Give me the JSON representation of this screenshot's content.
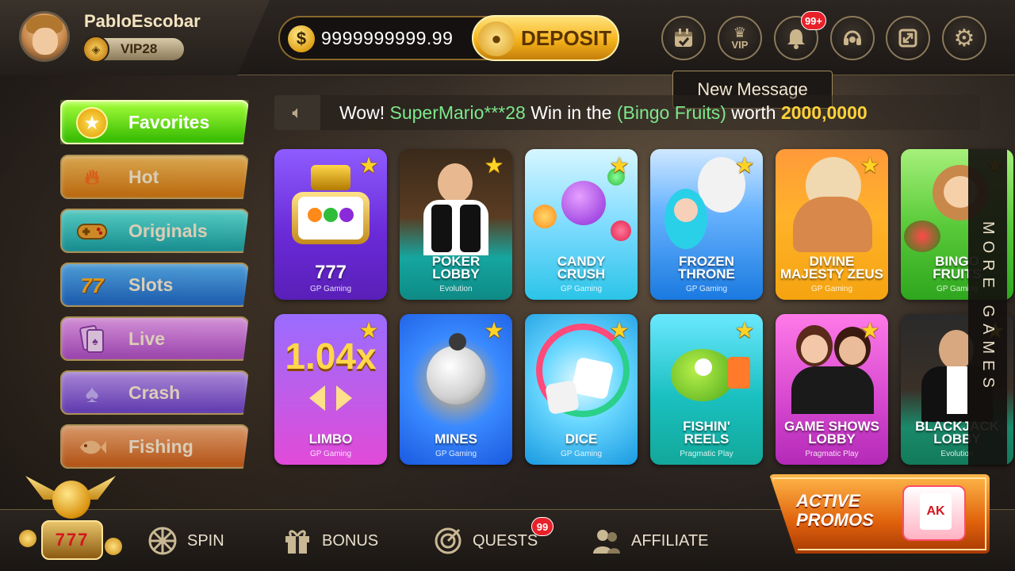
{
  "header": {
    "username": "PabloEscobar",
    "vip_label": "VIP28",
    "balance": "9999999999.99",
    "deposit_label": "DEPOSIT",
    "icons": [
      {
        "name": "calendar-icon"
      },
      {
        "name": "vip-crown-icon",
        "label": "VIP"
      },
      {
        "name": "bell-icon",
        "badge": "99+"
      },
      {
        "name": "support-headset-icon"
      },
      {
        "name": "fullscreen-icon"
      },
      {
        "name": "settings-gear-icon"
      }
    ],
    "tooltip": "New Message"
  },
  "sidebar": {
    "categories": [
      {
        "label": "Favorites",
        "icon": "star-icon",
        "active": true
      },
      {
        "label": "Hot",
        "icon": "flame-icon"
      },
      {
        "label": "Originals",
        "icon": "gamepad-icon"
      },
      {
        "label": "Slots",
        "icon": "seven-seven-icon"
      },
      {
        "label": "Live",
        "icon": "cards-icon"
      },
      {
        "label": "Crash",
        "icon": "spade-icon"
      },
      {
        "label": "Fishing",
        "icon": "fish-icon"
      }
    ]
  },
  "ticker": {
    "prefix": "Wow!",
    "user": "SuperMario***28",
    "mid": "Win in the",
    "game": "(Bingo Fruits)",
    "worth": "worth",
    "amount": "2000,0000",
    "icon": "speaker-icon"
  },
  "games": [
    {
      "name": "777",
      "provider": "GP Gaming"
    },
    {
      "name": "POKER LOBBY",
      "provider": "Evolution"
    },
    {
      "name": "CANDY CRUSH",
      "provider": "GP Gaming"
    },
    {
      "name": "FROZEN THRONE",
      "provider": "GP Gaming"
    },
    {
      "name": "DIVINE MAJESTY ZEUS",
      "provider": "GP Gaming"
    },
    {
      "name": "BINGO FRUITS",
      "provider": "GP Gaming"
    },
    {
      "name": "LIMBO",
      "provider": "GP Gaming",
      "art_text": "1.04x"
    },
    {
      "name": "MINES",
      "provider": "GP Gaming"
    },
    {
      "name": "DICE",
      "provider": "GP Gaming"
    },
    {
      "name": "FISHIN' REELS",
      "provider": "Pragmatic Play"
    },
    {
      "name": "GAME SHOWS LOBBY",
      "provider": "Pragmatic Play"
    },
    {
      "name": "BLACKJACK LOBBY",
      "provider": "Evolution"
    }
  ],
  "more_games_label": "MORE GAMES",
  "bottom_nav": {
    "jackpot_text": "777",
    "spin": "SPIN",
    "bonus": "BONUS",
    "quests": "QUESTS",
    "quests_badge": "99",
    "affiliate": "AFFILIATE",
    "promos_line1": "ACTIVE",
    "promos_line2": "PROMOS",
    "promo_card": "AK"
  },
  "colors": {
    "accent_gold": "#f5b31c",
    "ticker_green": "#7de88b",
    "ticker_amount": "#ffd23a",
    "badge_red": "#e8202a"
  }
}
